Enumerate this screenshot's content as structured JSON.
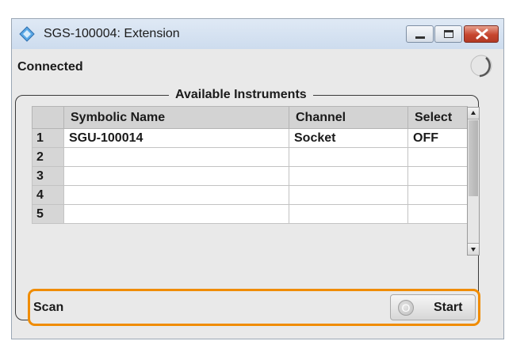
{
  "window": {
    "title": "SGS-100004: Extension"
  },
  "status": {
    "label": "Connected"
  },
  "instruments": {
    "group_title": "Available Instruments",
    "columns": [
      "Symbolic Name",
      "Channel",
      "Select"
    ],
    "rows": [
      {
        "num": "1",
        "name": "SGU-100014",
        "channel": "Socket",
        "select": "OFF"
      },
      {
        "num": "2",
        "name": "",
        "channel": "",
        "select": ""
      },
      {
        "num": "3",
        "name": "",
        "channel": "",
        "select": ""
      },
      {
        "num": "4",
        "name": "",
        "channel": "",
        "select": ""
      },
      {
        "num": "5",
        "name": "",
        "channel": "",
        "select": ""
      }
    ]
  },
  "scan": {
    "label": "Scan",
    "button_label": "Start",
    "button_indicator": "O"
  },
  "colors": {
    "highlight": "#f08c00",
    "close_button": "#c6462f"
  },
  "icons": [
    "app-diamond-icon",
    "minimize-icon",
    "maximize-icon",
    "close-icon",
    "status-led-icon",
    "scroll-up-arrow-icon",
    "scroll-down-arrow-icon"
  ]
}
